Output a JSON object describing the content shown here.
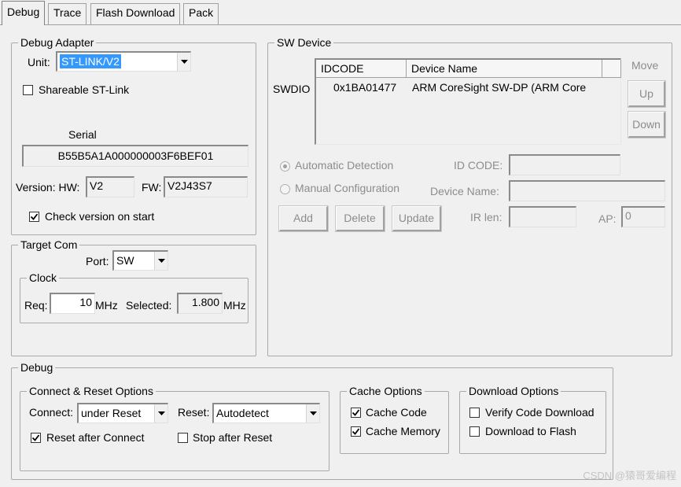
{
  "tabs": [
    "Debug",
    "Trace",
    "Flash Download",
    "Pack"
  ],
  "debug_adapter": {
    "title": "Debug Adapter",
    "unit_label": "Unit:",
    "unit_value": "ST-LINK/V2",
    "shareable_label": "Shareable ST-Link",
    "shareable_checked": false,
    "serial_label": "Serial",
    "serial_value": "B55B5A1A000000003F6BEF01",
    "version_label": "Version: HW:",
    "hw_value": "V2",
    "fw_label": "FW:",
    "fw_value": "V2J43S7",
    "check_version_label": "Check version on start",
    "check_version_checked": true
  },
  "target_com": {
    "title": "Target Com",
    "port_label": "Port:",
    "port_value": "SW",
    "clock": {
      "title": "Clock",
      "req_label": "Req:",
      "req_value": "10",
      "mhz1": "MHz",
      "selected_label": "Selected:",
      "selected_value": "1.800",
      "mhz2": "MHz"
    }
  },
  "sw_device": {
    "title": "SW Device",
    "columns": [
      "IDCODE",
      "Device Name"
    ],
    "row_label": "SWDIO",
    "rows": [
      {
        "idcode": "0x1BA01477",
        "name": "ARM CoreSight SW-DP (ARM Core"
      }
    ],
    "move_label": "Move",
    "up_label": "Up",
    "down_label": "Down",
    "auto_detect_label": "Automatic Detection",
    "manual_config_label": "Manual Configuration",
    "id_code_label": "ID CODE:",
    "device_name_label": "Device Name:",
    "ir_len_label": "IR len:",
    "ap_label": "AP:",
    "ap_value": "0",
    "add_label": "Add",
    "delete_label": "Delete",
    "update_label": "Update"
  },
  "debug": {
    "title": "Debug",
    "connect_reset": {
      "title": "Connect & Reset Options",
      "connect_label": "Connect:",
      "connect_value": "under Reset",
      "reset_label": "Reset:",
      "reset_value": "Autodetect",
      "reset_after_connect_label": "Reset after Connect",
      "reset_after_connect_checked": true,
      "stop_after_reset_label": "Stop after Reset",
      "stop_after_reset_checked": false
    },
    "cache": {
      "title": "Cache Options",
      "cache_code_label": "Cache Code",
      "cache_code_checked": true,
      "cache_memory_label": "Cache Memory",
      "cache_memory_checked": true
    },
    "download": {
      "title": "Download Options",
      "verify_label": "Verify Code Download",
      "verify_checked": false,
      "flash_label": "Download to Flash",
      "flash_checked": false
    }
  },
  "watermark": "CSDN @猿哥爱编程"
}
